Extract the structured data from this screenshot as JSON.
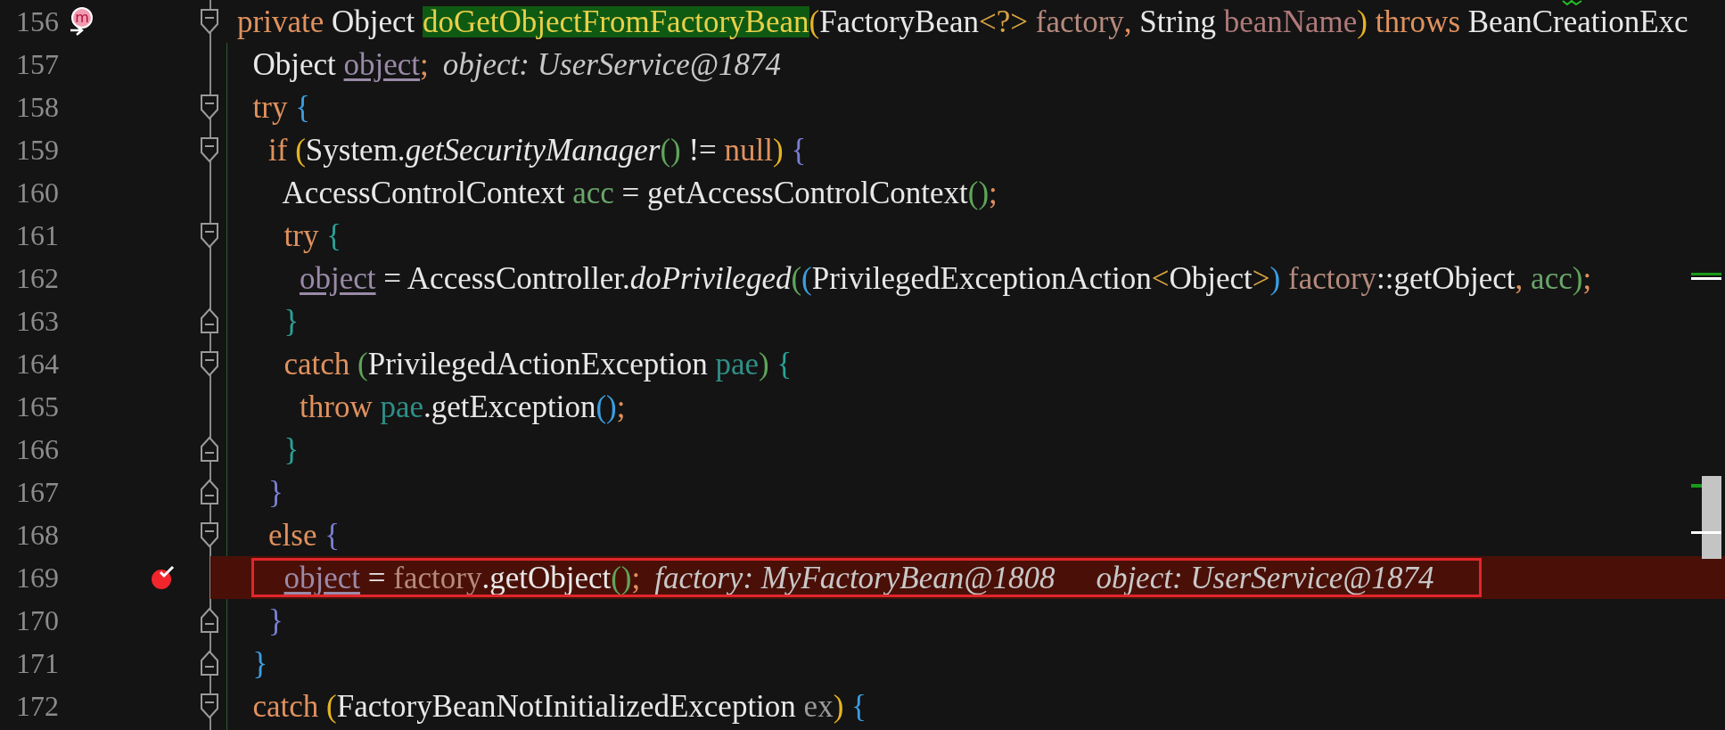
{
  "editor": {
    "lines": [
      {
        "number": "156",
        "fold_marker": {
          "kind": "start"
        },
        "gutter_icon": {
          "kind": "method",
          "glyph": "m"
        },
        "tokens": [
          {
            "kind": "keyword",
            "text": "private "
          },
          {
            "kind": "plain",
            "text": "Object "
          },
          {
            "kind": "method-decl",
            "text": "doGetObjectFromFactoryBean"
          },
          {
            "kind": "punct",
            "text": "(",
            "color": "#e6b422"
          },
          {
            "kind": "plain",
            "text": "FactoryBean"
          },
          {
            "kind": "punct",
            "text": "<?>",
            "color": "#d9a441"
          },
          {
            "kind": "param",
            "text": " factory"
          },
          {
            "kind": "punct",
            "text": ", ",
            "color": "#e0915e"
          },
          {
            "kind": "plain",
            "text": "String "
          },
          {
            "kind": "param2",
            "text": "beanName"
          },
          {
            "kind": "punct",
            "text": ")",
            "color": "#e6b422"
          },
          {
            "kind": "keyword",
            "text": " throws "
          },
          {
            "kind": "plain",
            "text": "BeanCreationExc"
          }
        ]
      },
      {
        "number": "157",
        "tokens": [
          {
            "kind": "plain",
            "text": "  Object "
          },
          {
            "kind": "field",
            "text": "object"
          },
          {
            "kind": "punct",
            "text": ";",
            "color": "#e0915e"
          },
          {
            "kind": "hint",
            "text": "object: UserService@1874"
          }
        ]
      },
      {
        "number": "158",
        "fold_marker": {
          "kind": "start"
        },
        "tokens": [
          {
            "kind": "keyword",
            "text": "  try "
          },
          {
            "kind": "punct",
            "text": "{",
            "color": "#3b9ee0"
          }
        ]
      },
      {
        "number": "159",
        "fold_marker": {
          "kind": "start"
        },
        "tokens": [
          {
            "kind": "keyword",
            "text": "    if "
          },
          {
            "kind": "punct",
            "text": "(",
            "color": "#e6b422"
          },
          {
            "kind": "plain",
            "text": "System."
          },
          {
            "kind": "method-call",
            "text": "getSecurityManager"
          },
          {
            "kind": "punct",
            "text": "()",
            "color": "#5fa55a"
          },
          {
            "kind": "plain",
            "text": " != "
          },
          {
            "kind": "keyword",
            "text": "null"
          },
          {
            "kind": "punct",
            "text": ")",
            "color": "#e6b422"
          },
          {
            "kind": "punct",
            "text": " {",
            "color": "#7b7fd4"
          }
        ]
      },
      {
        "number": "160",
        "tokens": [
          {
            "kind": "plain",
            "text": "      AccessControlContext "
          },
          {
            "kind": "local",
            "text": "acc"
          },
          {
            "kind": "plain",
            "text": " = getAccessControlContext"
          },
          {
            "kind": "punct",
            "text": "()",
            "color": "#5fa55a"
          },
          {
            "kind": "punct",
            "text": ";",
            "color": "#e0915e"
          }
        ]
      },
      {
        "number": "161",
        "fold_marker": {
          "kind": "start"
        },
        "tokens": [
          {
            "kind": "keyword",
            "text": "      try "
          },
          {
            "kind": "punct",
            "text": "{",
            "color": "#2aa198"
          }
        ]
      },
      {
        "number": "162",
        "tokens": [
          {
            "kind": "field",
            "text": "        object"
          },
          {
            "kind": "plain",
            "text": " = AccessController."
          },
          {
            "kind": "method-call",
            "text": "doPrivileged"
          },
          {
            "kind": "punct",
            "text": "(",
            "color": "#5fa55a"
          },
          {
            "kind": "punct",
            "text": "(",
            "color": "#3b9ee0"
          },
          {
            "kind": "plain",
            "text": "PrivilegedExceptionAction"
          },
          {
            "kind": "punct",
            "text": "<",
            "color": "#d9a441"
          },
          {
            "kind": "plain",
            "text": "Object"
          },
          {
            "kind": "punct",
            "text": ">",
            "color": "#d9a441"
          },
          {
            "kind": "punct",
            "text": ")",
            "color": "#3b9ee0"
          },
          {
            "kind": "param",
            "text": " factory"
          },
          {
            "kind": "plain",
            "text": "::getObject"
          },
          {
            "kind": "punct",
            "text": ", ",
            "color": "#e0915e"
          },
          {
            "kind": "local",
            "text": "acc"
          },
          {
            "kind": "punct",
            "text": ")",
            "color": "#5fa55a"
          },
          {
            "kind": "punct",
            "text": ";",
            "color": "#e0915e"
          }
        ]
      },
      {
        "number": "163",
        "fold_marker": {
          "kind": "end"
        },
        "tokens": [
          {
            "kind": "punct",
            "text": "      }",
            "color": "#2aa198"
          }
        ]
      },
      {
        "number": "164",
        "fold_marker": {
          "kind": "start"
        },
        "tokens": [
          {
            "kind": "keyword",
            "text": "      catch "
          },
          {
            "kind": "punct",
            "text": "(",
            "color": "#5fa55a"
          },
          {
            "kind": "plain",
            "text": "PrivilegedActionException "
          },
          {
            "kind": "local2",
            "text": "pae"
          },
          {
            "kind": "punct",
            "text": ")",
            "color": "#5fa55a"
          },
          {
            "kind": "punct",
            "text": " {",
            "color": "#2aa198"
          }
        ]
      },
      {
        "number": "165",
        "tokens": [
          {
            "kind": "keyword",
            "text": "        throw "
          },
          {
            "kind": "local2",
            "text": "pae"
          },
          {
            "kind": "plain",
            "text": ".getException"
          },
          {
            "kind": "punct",
            "text": "()",
            "color": "#3b9ee0"
          },
          {
            "kind": "punct",
            "text": ";",
            "color": "#e0915e"
          }
        ]
      },
      {
        "number": "166",
        "fold_marker": {
          "kind": "end"
        },
        "tokens": [
          {
            "kind": "punct",
            "text": "      }",
            "color": "#2aa198"
          }
        ]
      },
      {
        "number": "167",
        "fold_marker": {
          "kind": "end"
        },
        "tokens": [
          {
            "kind": "punct",
            "text": "    }",
            "color": "#7b7fd4"
          }
        ]
      },
      {
        "number": "168",
        "fold_marker": {
          "kind": "start"
        },
        "tokens": [
          {
            "kind": "keyword",
            "text": "    else "
          },
          {
            "kind": "punct",
            "text": "{",
            "color": "#7b7fd4"
          }
        ]
      },
      {
        "number": "169",
        "current": true,
        "annotated": true,
        "gutter_icon": {
          "kind": "breakpoint"
        },
        "tokens": [
          {
            "kind": "field",
            "text": "      object"
          },
          {
            "kind": "plain",
            "text": " = "
          },
          {
            "kind": "param",
            "text": "factory"
          },
          {
            "kind": "plain",
            "text": ".getObject"
          },
          {
            "kind": "punct",
            "text": "()",
            "color": "#5fa55a"
          },
          {
            "kind": "punct",
            "text": ";",
            "color": "#e0915e"
          },
          {
            "kind": "hint",
            "text": "factory: MyFactoryBean@1808"
          },
          {
            "kind": "hint-far",
            "text": "object: UserService@1874"
          }
        ]
      },
      {
        "number": "170",
        "fold_marker": {
          "kind": "end"
        },
        "tokens": [
          {
            "kind": "punct",
            "text": "    }",
            "color": "#7b7fd4"
          }
        ]
      },
      {
        "number": "171",
        "fold_marker": {
          "kind": "end"
        },
        "tokens": [
          {
            "kind": "punct",
            "text": "  }",
            "color": "#3b9ee0"
          }
        ]
      },
      {
        "number": "172",
        "fold_marker": {
          "kind": "start"
        },
        "tokens": [
          {
            "kind": "keyword",
            "text": "  catch "
          },
          {
            "kind": "punct",
            "text": "(",
            "color": "#e6b422"
          },
          {
            "kind": "plain",
            "text": "FactoryBeanNotInitializedException "
          },
          {
            "kind": "weak",
            "text": "ex"
          },
          {
            "kind": "punct",
            "text": ")",
            "color": "#e6b422"
          },
          {
            "kind": "punct",
            "text": " {",
            "color": "#3b9ee0"
          }
        ]
      }
    ]
  }
}
